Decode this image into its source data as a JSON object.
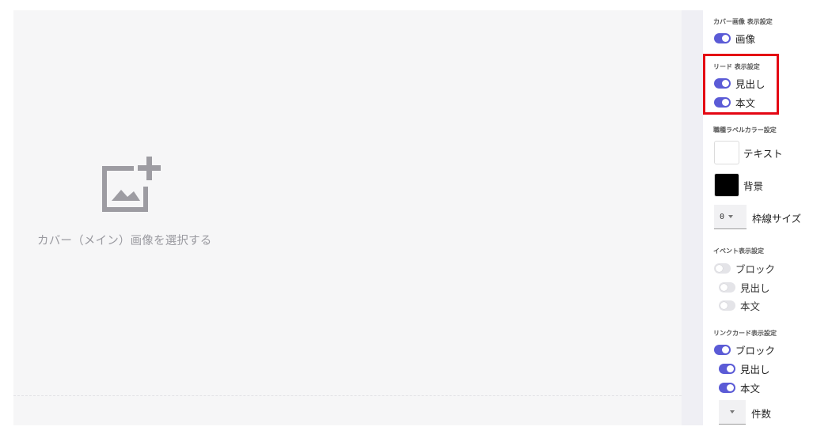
{
  "canvas": {
    "cover_prompt": "カバー（メイン）画像を選択する",
    "icon": "add-photo-icon"
  },
  "panel": {
    "cover_section": {
      "title": "カバー画像 表示設定",
      "toggles": [
        {
          "label": "画像",
          "on": true
        }
      ]
    },
    "lead_section": {
      "title": "リード 表示設定",
      "toggles": [
        {
          "label": "見出し",
          "on": true
        },
        {
          "label": "本文",
          "on": true
        }
      ]
    },
    "label_color_section": {
      "title": "職種ラベルカラー設定",
      "text_color_label": "テキスト",
      "text_color": "#ffffff",
      "background_color_label": "背景",
      "background_color": "#000000",
      "border_size_value": "0",
      "border_size_label": "枠線サイズ"
    },
    "event_section": {
      "title": "イベント表示設定",
      "toggles": [
        {
          "label": "ブロック",
          "on": false
        },
        {
          "label": "見出し",
          "on": false
        },
        {
          "label": "本文",
          "on": false
        }
      ]
    },
    "link_card_section": {
      "title": "リンクカード表示設定",
      "toggles": [
        {
          "label": "ブロック",
          "on": true
        },
        {
          "label": "見出し",
          "on": true
        },
        {
          "label": "本文",
          "on": true
        }
      ],
      "count_value": "",
      "count_label": "件数"
    }
  },
  "colors": {
    "accent": "#5b5bd6",
    "highlight": "#e40613",
    "canvas_bg": "#f6f6f7"
  }
}
